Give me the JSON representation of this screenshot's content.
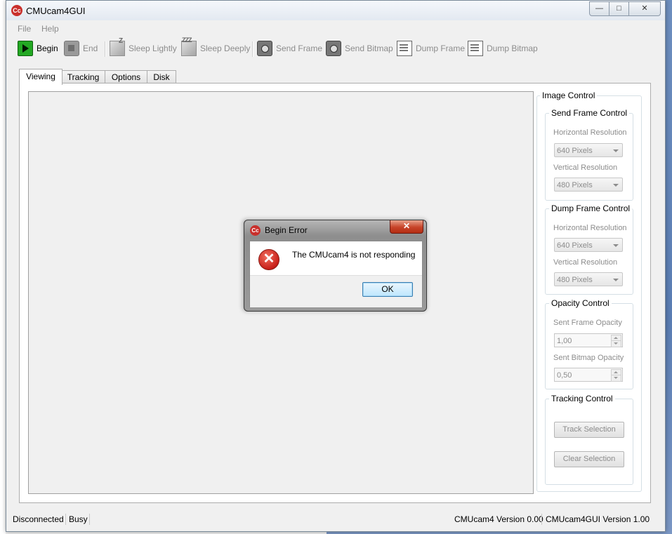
{
  "window": {
    "title": "CMUcam4GUI",
    "app_icon": "Cc",
    "minimize": "—",
    "maximize": "□",
    "close": "✕"
  },
  "menu": [
    "File",
    "Help"
  ],
  "toolbar": {
    "begin": "Begin",
    "end": "End",
    "sleep_lightly": "Sleep Lightly",
    "sleep_deeply": "Sleep Deeply",
    "send_frame": "Send Frame",
    "send_bitmap": "Send Bitmap",
    "dump_frame": "Dump Frame",
    "dump_bitmap": "Dump Bitmap",
    "sleep_lightly_glyph": "Z",
    "sleep_deeply_glyph": "ZZZ"
  },
  "tabs": [
    "Viewing",
    "Tracking",
    "Options",
    "Disk"
  ],
  "image_control": {
    "title": "Image Control",
    "send_frame": {
      "title": "Send Frame Control",
      "h_label": "Horizontal Resolution",
      "h_value": "640 Pixels",
      "v_label": "Vertical Resolution",
      "v_value": "480 Pixels"
    },
    "dump_frame": {
      "title": "Dump Frame Control",
      "h_label": "Horizontal Resolution",
      "h_value": "640 Pixels",
      "v_label": "Vertical Resolution",
      "v_value": "480 Pixels"
    },
    "opacity": {
      "title": "Opacity Control",
      "frame_label": "Sent Frame Opacity",
      "frame_value": "1,00",
      "bitmap_label": "Sent Bitmap Opacity",
      "bitmap_value": "0,50"
    },
    "tracking": {
      "title": "Tracking Control",
      "track": "Track Selection",
      "clear": "Clear Selection"
    }
  },
  "status": {
    "connection": "Disconnected",
    "state": "Busy",
    "cam_version": "CMUcam4 Version 0.00",
    "gui_version": "CMUcam4GUI Version 1.00"
  },
  "dialog": {
    "title": "Begin Error",
    "icon": "Cc",
    "message": "The CMUcam4 is not responding",
    "ok": "OK",
    "close": "✕",
    "error_glyph": "✕"
  },
  "colors": {
    "accent": "#23a823",
    "error": "#c8201a",
    "dialog_close": "#c74329"
  }
}
